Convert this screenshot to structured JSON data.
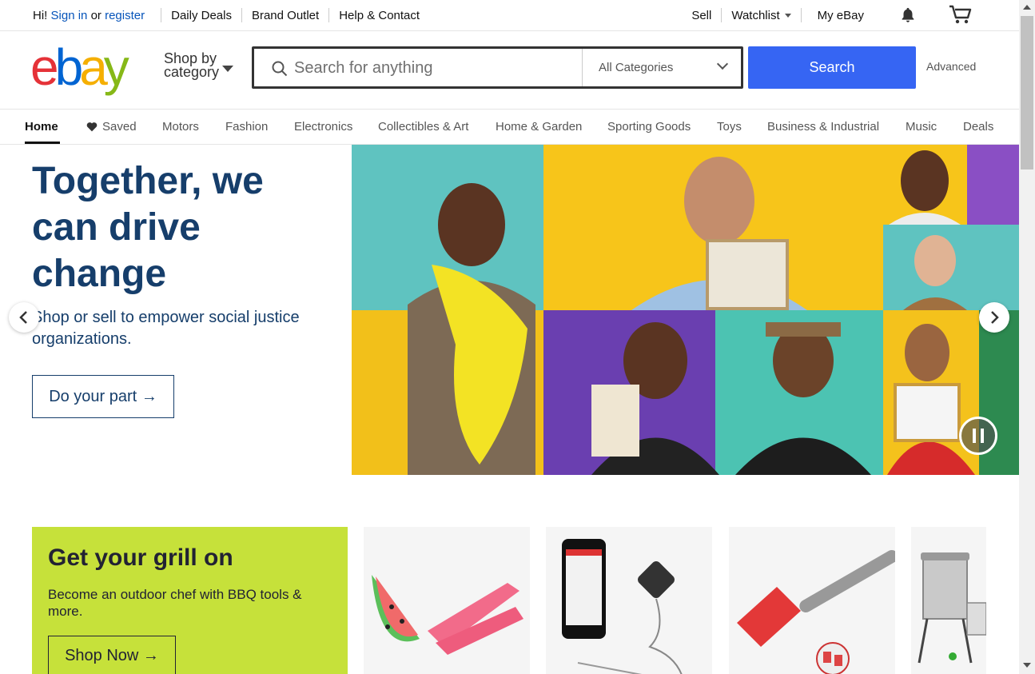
{
  "topbar": {
    "greeting": "Hi!",
    "sign_in": "Sign in",
    "or": "or",
    "register": "register",
    "links": [
      "Daily Deals",
      "Brand Outlet",
      "Help & Contact"
    ],
    "sell": "Sell",
    "watchlist": "Watchlist",
    "my_ebay": "My eBay"
  },
  "header": {
    "logo": [
      "e",
      "b",
      "a",
      "y"
    ],
    "shop_by_line1": "Shop by",
    "shop_by_line2": "category",
    "search_placeholder": "Search for anything",
    "category_selected": "All Categories",
    "search_button": "Search",
    "advanced": "Advanced"
  },
  "nav": {
    "items": [
      "Home",
      "Saved",
      "Motors",
      "Fashion",
      "Electronics",
      "Collectibles & Art",
      "Home & Garden",
      "Sporting Goods",
      "Toys",
      "Business & Industrial",
      "Music",
      "Deals"
    ]
  },
  "hero": {
    "title": "Together, we can drive change",
    "subtitle": "Shop or sell to empower social justice organizations.",
    "button": "Do your part",
    "arrow": "→"
  },
  "promo": {
    "title": "Get your grill on",
    "subtitle": "Become an outdoor chef with BBQ tools & more.",
    "button": "Shop Now",
    "arrow": "→"
  },
  "colors": {
    "accent": "#3665f3",
    "hero_text": "#163e6b",
    "promo_bg": "#c6e13a"
  }
}
